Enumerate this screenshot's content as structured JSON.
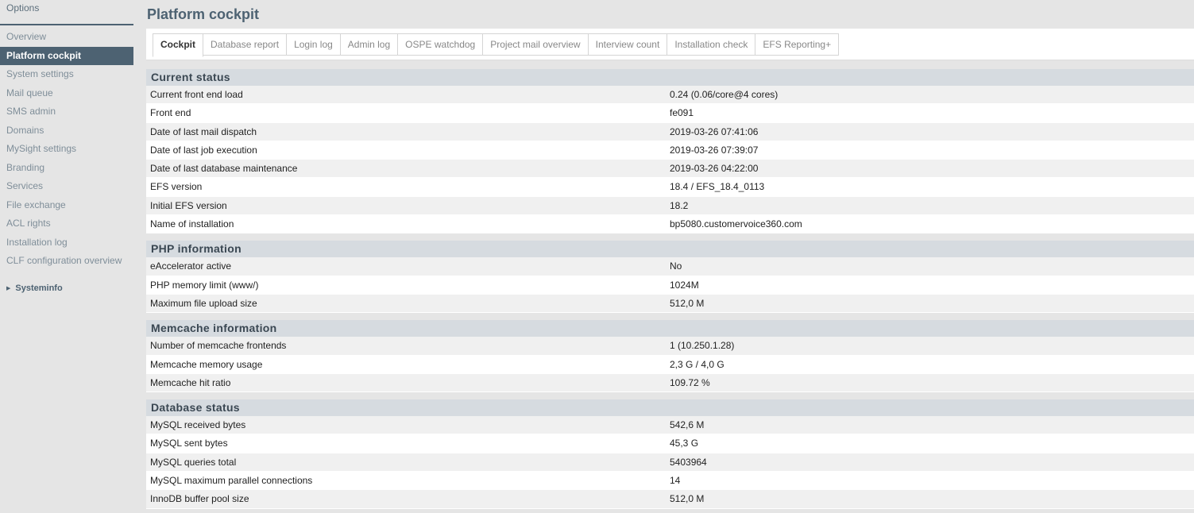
{
  "sidebar": {
    "header": "Options",
    "items": [
      {
        "label": "Overview"
      },
      {
        "label": "Platform cockpit",
        "active": true
      },
      {
        "label": "System settings"
      },
      {
        "label": "Mail queue"
      },
      {
        "label": "SMS admin"
      },
      {
        "label": "Domains"
      },
      {
        "label": "MySight settings"
      },
      {
        "label": "Branding"
      },
      {
        "label": "Services"
      },
      {
        "label": "File exchange"
      },
      {
        "label": "ACL rights"
      },
      {
        "label": "Installation log"
      },
      {
        "label": "CLF configuration overview"
      }
    ],
    "sub_label": "Systeminfo"
  },
  "page": {
    "title": "Platform cockpit"
  },
  "tabs": [
    {
      "label": "Cockpit",
      "active": true
    },
    {
      "label": "Database report"
    },
    {
      "label": "Login log"
    },
    {
      "label": "Admin log"
    },
    {
      "label": "OSPE watchdog"
    },
    {
      "label": "Project mail overview"
    },
    {
      "label": "Interview count"
    },
    {
      "label": "Installation check"
    },
    {
      "label": "EFS Reporting+"
    }
  ],
  "sections": [
    {
      "title": "Current status",
      "rows": [
        {
          "label": "Current front end load",
          "value": "0.24 (0.06/core@4 cores)"
        },
        {
          "label": "Front end",
          "value": "fe091"
        },
        {
          "label": "Date of last mail dispatch",
          "value": "2019-03-26 07:41:06"
        },
        {
          "label": "Date of last job execution",
          "value": "2019-03-26 07:39:07"
        },
        {
          "label": "Date of last database maintenance",
          "value": "2019-03-26 04:22:00"
        },
        {
          "label": "EFS version",
          "value": "18.4 / EFS_18.4_0113"
        },
        {
          "label": "Initial EFS version",
          "value": "18.2"
        },
        {
          "label": "Name of installation",
          "value": "bp5080.customervoice360.com"
        }
      ]
    },
    {
      "title": "PHP information",
      "rows": [
        {
          "label": "eAccelerator active",
          "value": "No"
        },
        {
          "label": "PHP memory limit (www/)",
          "value": "1024M"
        },
        {
          "label": "Maximum file upload size",
          "value": "512,0 M"
        }
      ]
    },
    {
      "title": "Memcache information",
      "rows": [
        {
          "label": "Number of memcache frontends",
          "value": "1 (10.250.1.28)"
        },
        {
          "label": "Memcache memory usage",
          "value": "2,3 G / 4,0 G"
        },
        {
          "label": "Memcache hit ratio",
          "value": "109.72 %"
        }
      ]
    },
    {
      "title": "Database status",
      "rows": [
        {
          "label": "MySQL received bytes",
          "value": "542,6 M"
        },
        {
          "label": "MySQL sent bytes",
          "value": "45,3 G"
        },
        {
          "label": "MySQL queries total",
          "value": "5403964"
        },
        {
          "label": "MySQL maximum parallel connections",
          "value": "14"
        },
        {
          "label": "InnoDB buffer pool size",
          "value": "512,0 M"
        }
      ]
    }
  ]
}
